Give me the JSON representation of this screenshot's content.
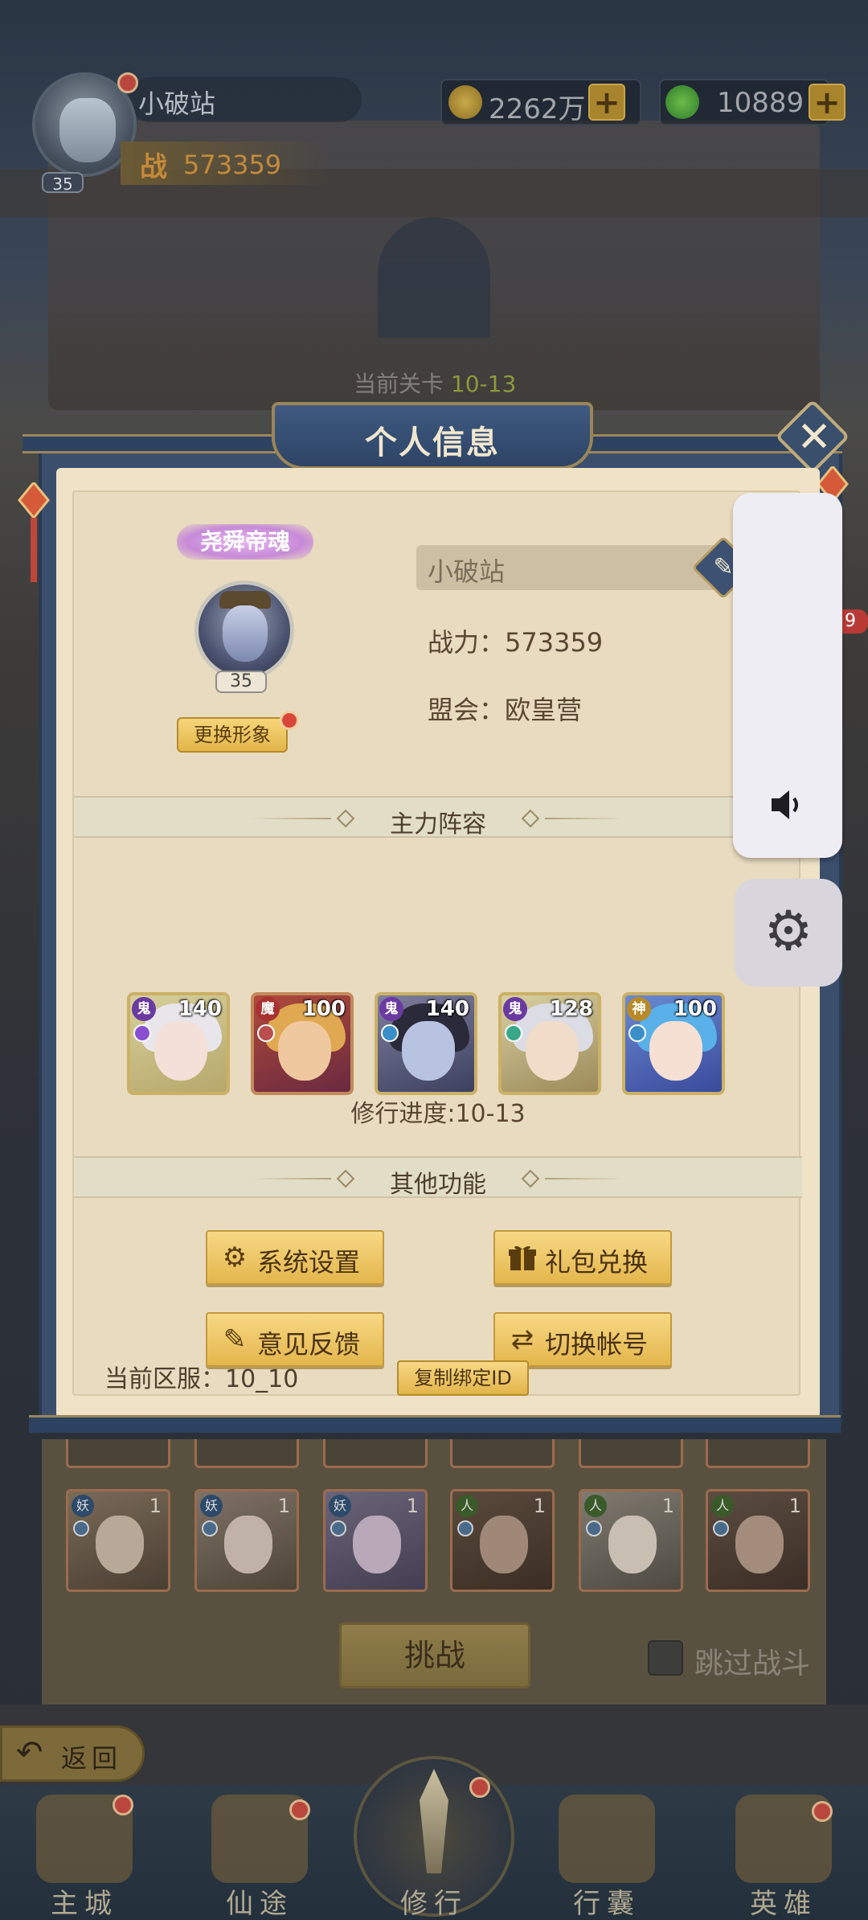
{
  "hud": {
    "player_name": "小破站",
    "level": "35",
    "power_icon": "战",
    "power": "573359",
    "gold": "2262万",
    "jade": "10889",
    "plus": "+",
    "stage_prefix": "当前关卡",
    "stage_value": "10-13"
  },
  "modal": {
    "title": "个人信息",
    "close_glyph": "✕",
    "profile": {
      "title_badge": "尧舜帝魂",
      "level": "35",
      "change_look": "更换形象",
      "name": "小破站",
      "edit_glyph": "✎",
      "power": "战力：573359",
      "guild": "盟会：欧皇营"
    },
    "lineup": {
      "title": "主力阵容",
      "heroes": [
        {
          "faction": "鬼",
          "level": "140"
        },
        {
          "faction": "魔",
          "level": "100"
        },
        {
          "faction": "鬼",
          "level": "140"
        },
        {
          "faction": "鬼",
          "level": "128"
        },
        {
          "faction": "神",
          "level": "100"
        }
      ],
      "progress": "修行进度:10-13"
    },
    "functions": {
      "title": "其他功能",
      "buttons": [
        {
          "label": "系统设置",
          "icon": "gear-icon",
          "glyph": "⚙"
        },
        {
          "label": "礼包兑换",
          "icon": "gift-icon",
          "glyph": "🎁"
        },
        {
          "label": "意见反馈",
          "icon": "pencil-icon",
          "glyph": "✎"
        },
        {
          "label": "切换帐号",
          "icon": "switch-icon",
          "glyph": "⇄"
        }
      ],
      "server": "当前区服：10_10",
      "copy_id": "复制绑定ID"
    }
  },
  "side": {
    "qq_badge": "9",
    "speaker_icon": "speaker-icon",
    "gear_glyph": "⚙"
  },
  "lower": {
    "cards": [
      {
        "faction": "妖",
        "level": "1"
      },
      {
        "faction": "妖",
        "level": "1"
      },
      {
        "faction": "妖",
        "level": "1"
      },
      {
        "faction": "人",
        "level": "1"
      },
      {
        "faction": "人",
        "level": "1"
      },
      {
        "faction": "人",
        "level": "1"
      }
    ],
    "challenge": "挑战",
    "skip": "跳过战斗",
    "back": "返回",
    "back_glyph": "↶"
  },
  "nav": {
    "items": [
      "主城",
      "仙途",
      "修行",
      "行囊",
      "英雄"
    ]
  },
  "colors": {
    "modal_blue": "#3b4f6d",
    "paper": "#efe2c7",
    "gold_button": "#e4b64c",
    "text_brown": "#4e3f2d"
  }
}
